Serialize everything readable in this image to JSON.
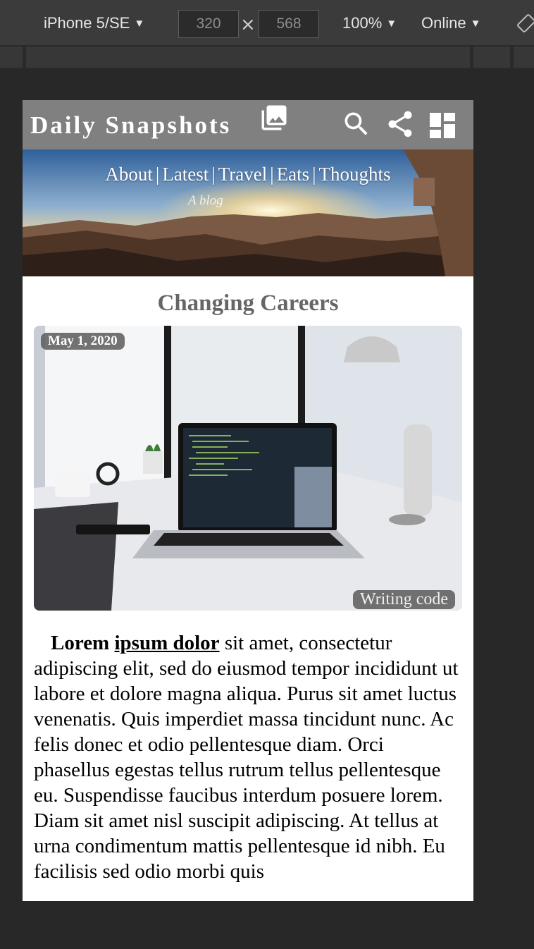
{
  "devtools": {
    "device": "iPhone 5/SE",
    "width_value": "320",
    "height_value": "568",
    "times_symbol": "×",
    "zoom": "100%",
    "network": "Online",
    "dropdown_caret": "▼"
  },
  "site": {
    "title": "Daily Snapshots",
    "icons": [
      "photo-library-icon",
      "search-icon",
      "share-icon",
      "dashboard-icon"
    ],
    "nav": [
      "About",
      "Latest",
      "Travel",
      "Eats",
      "Thoughts"
    ],
    "nav_separator": "|",
    "tagline": "A blog"
  },
  "post": {
    "title": "Changing Careers",
    "date": "May 1, 2020",
    "photo_caption": "Writing code",
    "lead_bold": "Lorem",
    "lead_link": "ipsum dolor",
    "body": " sit amet, consectetur adipiscing elit, sed do eiusmod tempor incididunt ut labore et dolore magna aliqua. Purus sit amet luctus venenatis. Quis imperdiet massa tincidunt nunc. Ac felis donec et odio pellentesque diam. Orci phasellus egestas tellus rutrum tellus pellentesque eu. Suspendisse faucibus interdum posuere lorem. Diam sit amet nisl suscipit adipiscing. At tellus at urna condimentum mattis pellentesque id nibh. Eu facilisis sed odio morbi quis"
  }
}
